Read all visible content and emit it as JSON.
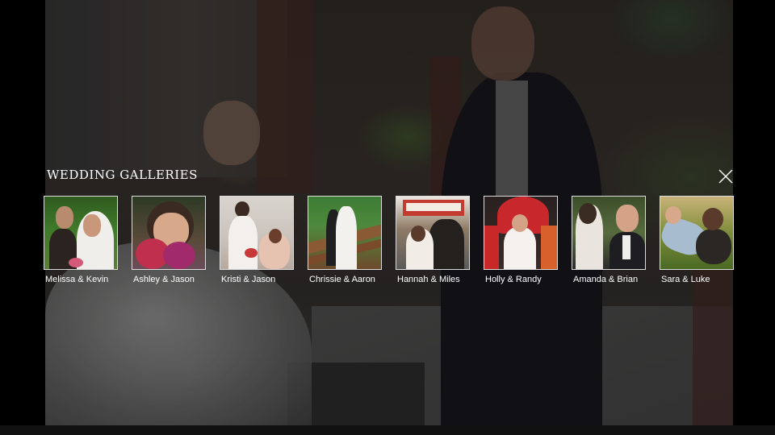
{
  "gallery": {
    "title": "WEDDING GALLERIES",
    "close_icon": "close-icon",
    "items": [
      {
        "label": "Melissa & Kevin"
      },
      {
        "label": "Ashley & Jason"
      },
      {
        "label": "Kristi & Jason"
      },
      {
        "label": "Chrissie & Aaron"
      },
      {
        "label": "Hannah & Miles"
      },
      {
        "label": "Holly & Randy"
      },
      {
        "label": "Amanda & Brian"
      },
      {
        "label": "Sara & Luke"
      }
    ]
  },
  "colors": {
    "background": "#000000",
    "text": "#ffffff",
    "thumb_border": "#dcdcdc"
  }
}
